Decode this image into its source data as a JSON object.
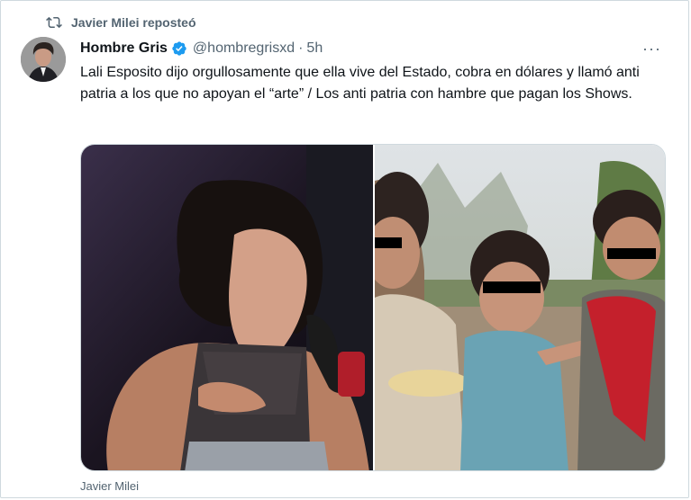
{
  "repost": {
    "label": "Javier Milei reposteó",
    "icon": "repost-icon"
  },
  "tweet": {
    "author_name": "Hombre Gris",
    "handle": "@hombregrisxd",
    "separator": "·",
    "time": "5h",
    "verified_color": "#1d9bf0",
    "more_label": "···",
    "text": "Lali Esposito dijo orgullosamente que ella vive del Estado, cobra en dólares y llamó anti patria a los que no apoyan el “arte” / Los anti patria con hambre que pagan los Shows."
  },
  "footer": {
    "caption": "Javier Milei"
  }
}
